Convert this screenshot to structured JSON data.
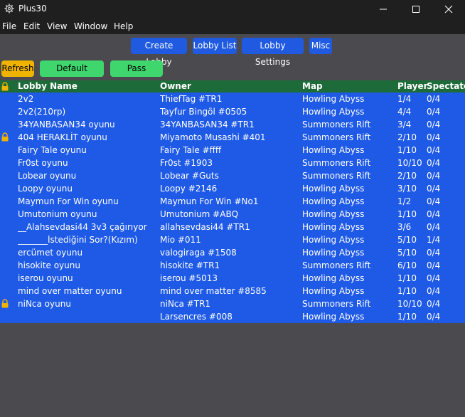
{
  "window": {
    "title": "Plus30",
    "icon": "gear-icon"
  },
  "menu": [
    "File",
    "Edit",
    "View",
    "Window",
    "Help"
  ],
  "tabs": [
    "Create Lobby",
    "Lobby List",
    "Lobby Settings",
    "Misc"
  ],
  "actions": {
    "refresh": "Refresh",
    "default_lobbies": "Default Lobbies",
    "pass_lobbies": "Pass Lobbies"
  },
  "colors": {
    "background": "#4b4b4f",
    "header_row": "#1d6b39",
    "table_body": "#1e5ae6",
    "tab_button": "#1f5ae0",
    "refresh_button": "#f0b400",
    "green_button": "#3fd66e",
    "lock": "#f0b400"
  },
  "table": {
    "columns": [
      "Lobby Name",
      "Owner",
      "Map",
      "Player",
      "Spectator"
    ],
    "header_lock_icon": "lock-icon",
    "rows": [
      {
        "locked": false,
        "name": "2v2",
        "owner": "ThiefTag #TR1",
        "map": "Howling Abyss",
        "player": "1/4",
        "spectator": "0/4"
      },
      {
        "locked": false,
        "name": "2v2(210rp)",
        "owner": "Tayfur Bingöl #0505",
        "map": "Howling Abyss",
        "player": "4/4",
        "spectator": "0/4"
      },
      {
        "locked": false,
        "name": "34YANBASAN34 oyunu",
        "owner": "34YANBASAN34 #TR1",
        "map": "Summoners Rift",
        "player": "3/4",
        "spectator": "0/4"
      },
      {
        "locked": true,
        "name": "404 HERAKLİT oyunu",
        "owner": "Miyamoto Musashi #401",
        "map": "Summoners Rift",
        "player": "2/10",
        "spectator": "0/4"
      },
      {
        "locked": false,
        "name": "Fairy Tale oyunu",
        "owner": "Fairy Tale #ffff",
        "map": "Howling Abyss",
        "player": "1/10",
        "spectator": "0/4"
      },
      {
        "locked": false,
        "name": "Fr0st oyunu",
        "owner": "Fr0st #1903",
        "map": "Summoners Rift",
        "player": "10/10",
        "spectator": "0/4"
      },
      {
        "locked": false,
        "name": "Lobear oyunu",
        "owner": "Lobear #Guts",
        "map": "Summoners Rift",
        "player": "2/10",
        "spectator": "0/4"
      },
      {
        "locked": false,
        "name": "Loopy oyunu",
        "owner": "Loopy #2146",
        "map": "Howling Abyss",
        "player": "3/10",
        "spectator": "0/4"
      },
      {
        "locked": false,
        "name": "Maymun For Win oyunu",
        "owner": "Maymun For Win #No1",
        "map": "Howling Abyss",
        "player": "1/2",
        "spectator": "0/4"
      },
      {
        "locked": false,
        "name": "Umutonium oyunu",
        "owner": "Umutonium #ABQ",
        "map": "Howling Abyss",
        "player": "1/10",
        "spectator": "0/4"
      },
      {
        "locked": false,
        "name": "__Alahsevdasi44 3v3 çağırıyor",
        "owner": "allahsevdasi44 #TR1",
        "map": "Howling Abyss",
        "player": "3/6",
        "spectator": "0/4"
      },
      {
        "locked": false,
        "name": "_______İstediğini Sor?(Kızım)",
        "owner": "Mio #011",
        "map": "Howling Abyss",
        "player": "5/10",
        "spectator": "1/4"
      },
      {
        "locked": false,
        "name": "ercümet oyunu",
        "owner": "valogiraga #1508",
        "map": "Howling Abyss",
        "player": "5/10",
        "spectator": "0/4"
      },
      {
        "locked": false,
        "name": "hisokite oyunu",
        "owner": "hisokite #TR1",
        "map": "Summoners Rift",
        "player": "6/10",
        "spectator": "0/4"
      },
      {
        "locked": false,
        "name": "iserou oyunu",
        "owner": "iserou #5013",
        "map": "Howling Abyss",
        "player": "1/10",
        "spectator": "0/4"
      },
      {
        "locked": false,
        "name": "mind over matter oyunu",
        "owner": "mind over matter #8585",
        "map": "Howling Abyss",
        "player": "1/10",
        "spectator": "0/4"
      },
      {
        "locked": true,
        "name": "niNca oyunu",
        "owner": "niNca #TR1",
        "map": "Summoners Rift",
        "player": "10/10",
        "spectator": "0/4"
      },
      {
        "locked": false,
        "name": "",
        "owner": "Larsencres #008",
        "map": "Howling Abyss",
        "player": "1/10",
        "spectator": "0/4"
      }
    ]
  }
}
